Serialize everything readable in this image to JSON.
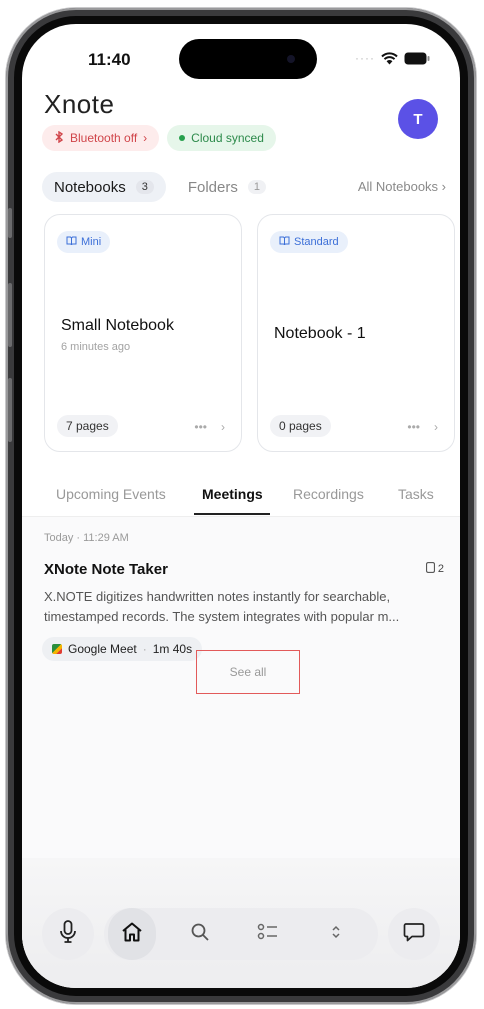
{
  "status_bar": {
    "time": "11:40"
  },
  "header": {
    "brand_x": "X",
    "brand_rest": "note",
    "avatar_initial": "T",
    "bluetooth_label": "Bluetooth off",
    "bluetooth_chevron": "›",
    "cloud_label": "Cloud synced"
  },
  "notebook_tabs": {
    "notebooks_label": "Notebooks",
    "notebooks_count": "3",
    "folders_label": "Folders",
    "folders_count": "1",
    "all_notebooks": "All Notebooks ›"
  },
  "cards": [
    {
      "tag": "Mini",
      "name": "Small Notebook",
      "time": "6 minutes ago",
      "pages": "7 pages",
      "actions_more": "•••",
      "actions_chevron": "›"
    },
    {
      "tag": "Standard",
      "name": "Notebook - 1",
      "time": "",
      "pages": "0 pages",
      "actions_more": "•••",
      "actions_chevron": "›"
    }
  ],
  "section_tabs": [
    "Upcoming Events",
    "Meetings",
    "Recordings",
    "Tasks"
  ],
  "active_section": "Meetings",
  "meeting": {
    "date": "Today · 11:29 AM",
    "title": "XNote Note Taker",
    "badge_count": "2",
    "description": "X.NOTE digitizes handwritten notes instantly for searchable, timestamped records. The system integrates with popular m...",
    "platform": "Google Meet",
    "separator": "·",
    "duration": "1m 40s"
  },
  "see_all_label": "See all",
  "bottom_nav": {
    "items": [
      "microphone-icon",
      "home-icon",
      "search-icon",
      "tasks-icon",
      "expand-icon",
      "chat-icon"
    ],
    "active": "home-icon"
  },
  "colors": {
    "avatar": "#5b51e6",
    "bluetooth_off": "#d0454a",
    "cloud_synced": "#2d8a4b",
    "tag_blue": "#3c6fd8",
    "highlight_border": "#e25a5a"
  }
}
